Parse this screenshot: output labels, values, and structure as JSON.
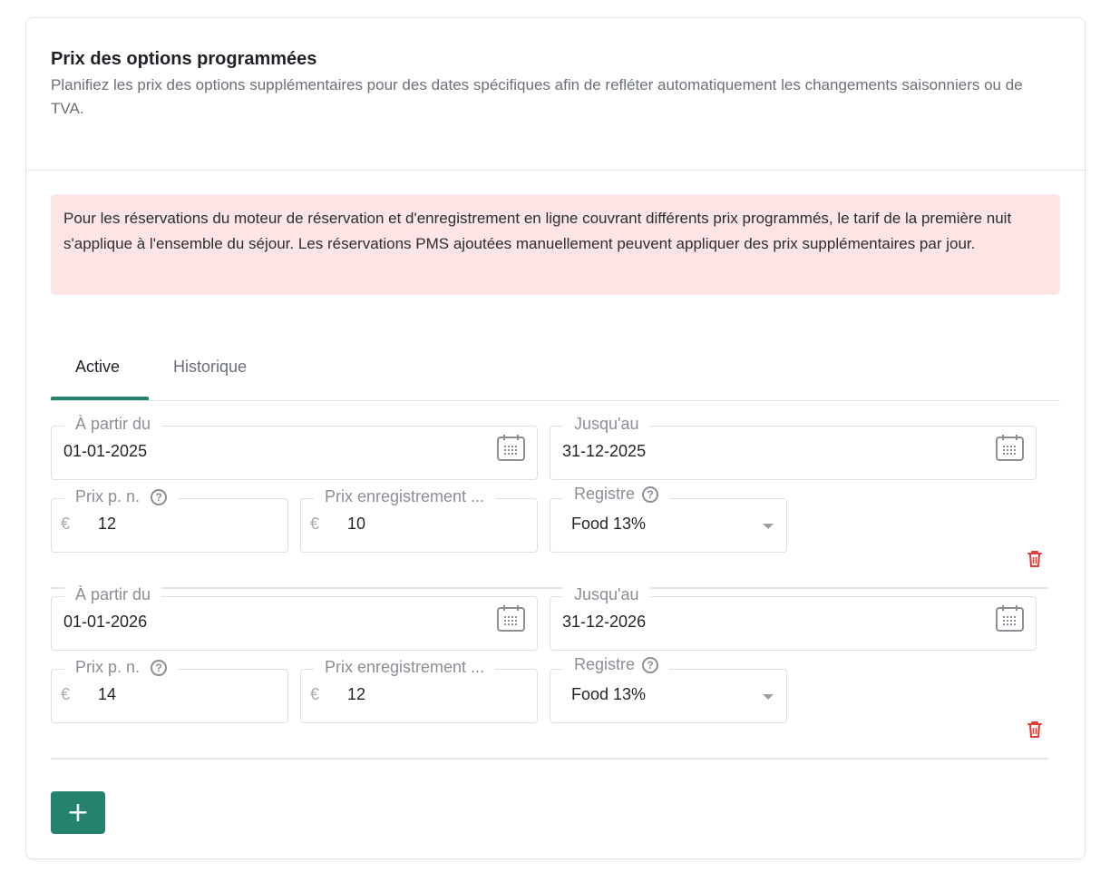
{
  "section": {
    "title": "Prix des options programmées",
    "subtitle": "Planifiez les prix des options supplémentaires pour des dates spécifiques afin de refléter automatiquement les changements saisonniers ou de TVA."
  },
  "alert": {
    "text": "Pour les réservations du moteur de réservation et d'enregistrement en ligne couvrant différents prix programmés, le tarif de la première nuit s'applique à l'ensemble du séjour. Les réservations PMS ajoutées manuellement peuvent appliquer des prix supplémentaires par jour."
  },
  "tabs": [
    {
      "label": "Active",
      "active": true
    },
    {
      "label": "Historique",
      "active": false
    }
  ],
  "labels": {
    "from": "À partir du",
    "until": "Jusqu'au",
    "price_per_night": "Prix p. n.",
    "checkin_price": "Prix enregistrement ...",
    "register": "Registre",
    "currency": "€",
    "help": "?"
  },
  "entries": [
    {
      "from": "01-01-2025",
      "until": "31-12-2025",
      "price_per_night": "12",
      "checkin_price": "10",
      "register": "Food 13%"
    },
    {
      "from": "01-01-2026",
      "until": "31-12-2026",
      "price_per_night": "14",
      "checkin_price": "12",
      "register": "Food 13%"
    }
  ],
  "add_button": {
    "label": "+"
  },
  "colors": {
    "accent": "#24826e",
    "alert_bg": "#fde5e5",
    "delete": "#e53935"
  }
}
